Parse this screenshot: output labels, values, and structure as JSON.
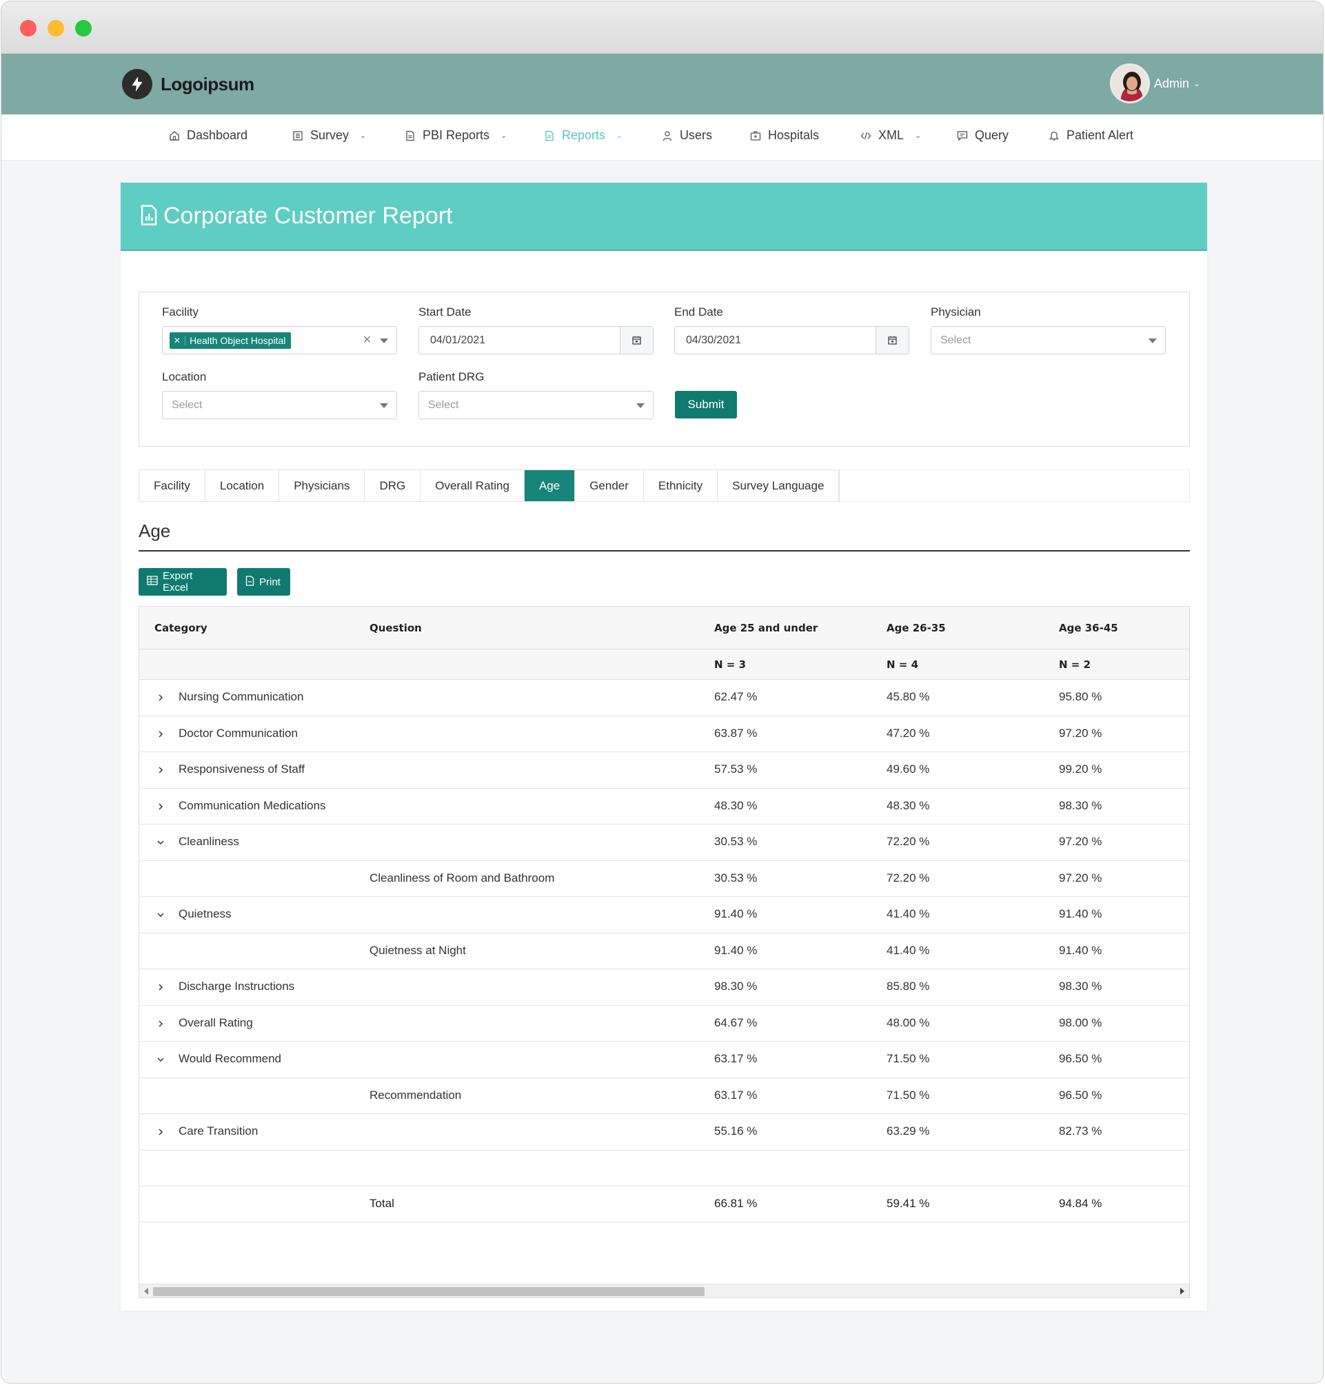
{
  "app": {
    "logo_text": "Logoipsum",
    "user_name": "Admin"
  },
  "nav": {
    "items": [
      {
        "label": "Dashboard",
        "icon": "home-icon"
      },
      {
        "label": "Survey",
        "icon": "list-icon"
      },
      {
        "label": "PBI Reports",
        "icon": "document-icon"
      },
      {
        "label": "Reports",
        "icon": "document-icon"
      },
      {
        "label": "Users",
        "icon": "user-icon"
      },
      {
        "label": "Hospitals",
        "icon": "hospital-icon"
      },
      {
        "label": "XML",
        "icon": "code-icon"
      },
      {
        "label": "Query",
        "icon": "chat-icon"
      },
      {
        "label": "Patient Alert",
        "icon": "bell-icon"
      }
    ],
    "active": "Reports"
  },
  "page": {
    "title": "Corporate Customer Report"
  },
  "filters": {
    "facility_label": "Facility",
    "facility_tag": "Health Object Hospital",
    "start_date_label": "Start Date",
    "start_date_value": "04/01/2021",
    "end_date_label": "End Date",
    "end_date_value": "04/30/2021",
    "physician_label": "Physician",
    "physician_placeholder": "Select",
    "location_label": "Location",
    "location_placeholder": "Select",
    "drg_label": "Patient DRG",
    "drg_placeholder": "Select",
    "submit_label": "Submit"
  },
  "tabs": [
    "Facility",
    "Location",
    "Physicians",
    "DRG",
    "Overall Rating",
    "Age",
    "Gender",
    "Ethnicity",
    "Survey Language"
  ],
  "active_tab": "Age",
  "section": {
    "title": "Age",
    "export_label": "Export Excel",
    "print_label": "Print"
  },
  "table": {
    "columns": [
      "Category",
      "Question",
      "Age 25 and under",
      "Age 26-35",
      "Age 36-45"
    ],
    "n_values": [
      "N = 3",
      "N = 4",
      "N = 2"
    ],
    "rows": [
      {
        "category": "Nursing Communication",
        "question": "",
        "values": [
          "62.47 %",
          "45.80 %",
          "95.80 %"
        ],
        "expanded": false
      },
      {
        "category": "Doctor Communication",
        "question": "",
        "values": [
          "63.87 %",
          "47.20 %",
          "97.20 %"
        ],
        "expanded": false
      },
      {
        "category": "Responsiveness of Staff",
        "question": "",
        "values": [
          "57.53 %",
          "49.60 %",
          "99.20 %"
        ],
        "expanded": false
      },
      {
        "category": "Communication Medications",
        "question": "",
        "values": [
          "48.30 %",
          "48.30 %",
          "98.30 %"
        ],
        "expanded": false
      },
      {
        "category": "Cleanliness",
        "question": "",
        "values": [
          "30.53 %",
          "72.20 %",
          "97.20 %"
        ],
        "expanded": true
      },
      {
        "category": "",
        "question": "Cleanliness of Room and Bathroom",
        "values": [
          "30.53 %",
          "72.20 %",
          "97.20 %"
        ],
        "child": true
      },
      {
        "category": "Quietness",
        "question": "",
        "values": [
          "91.40 %",
          "41.40 %",
          "91.40 %"
        ],
        "expanded": true
      },
      {
        "category": "",
        "question": "Quietness at Night",
        "values": [
          "91.40 %",
          "41.40 %",
          "91.40 %"
        ],
        "child": true
      },
      {
        "category": "Discharge Instructions",
        "question": "",
        "values": [
          "98.30 %",
          "85.80 %",
          "98.30 %"
        ],
        "expanded": false
      },
      {
        "category": "Overall Rating",
        "question": "",
        "values": [
          "64.67 %",
          "48.00 %",
          "98.00 %"
        ],
        "expanded": false
      },
      {
        "category": "Would Recommend",
        "question": "",
        "values": [
          "63.17 %",
          "71.50 %",
          "96.50 %"
        ],
        "expanded": true
      },
      {
        "category": "",
        "question": "Recommendation",
        "values": [
          "63.17 %",
          "71.50 %",
          "96.50 %"
        ],
        "child": true
      },
      {
        "category": "Care Transition",
        "question": "",
        "values": [
          "55.16 %",
          "63.29 %",
          "82.73 %"
        ],
        "expanded": false
      }
    ],
    "total": {
      "label": "Total",
      "values": [
        "66.81 %",
        "59.41 %",
        "94.84 %"
      ]
    }
  },
  "colors": {
    "header_teal": "#7fa9a3",
    "banner_teal": "#5ecdc4",
    "primary_dark_teal": "#107a70",
    "active_nav": "#55c6bd"
  }
}
